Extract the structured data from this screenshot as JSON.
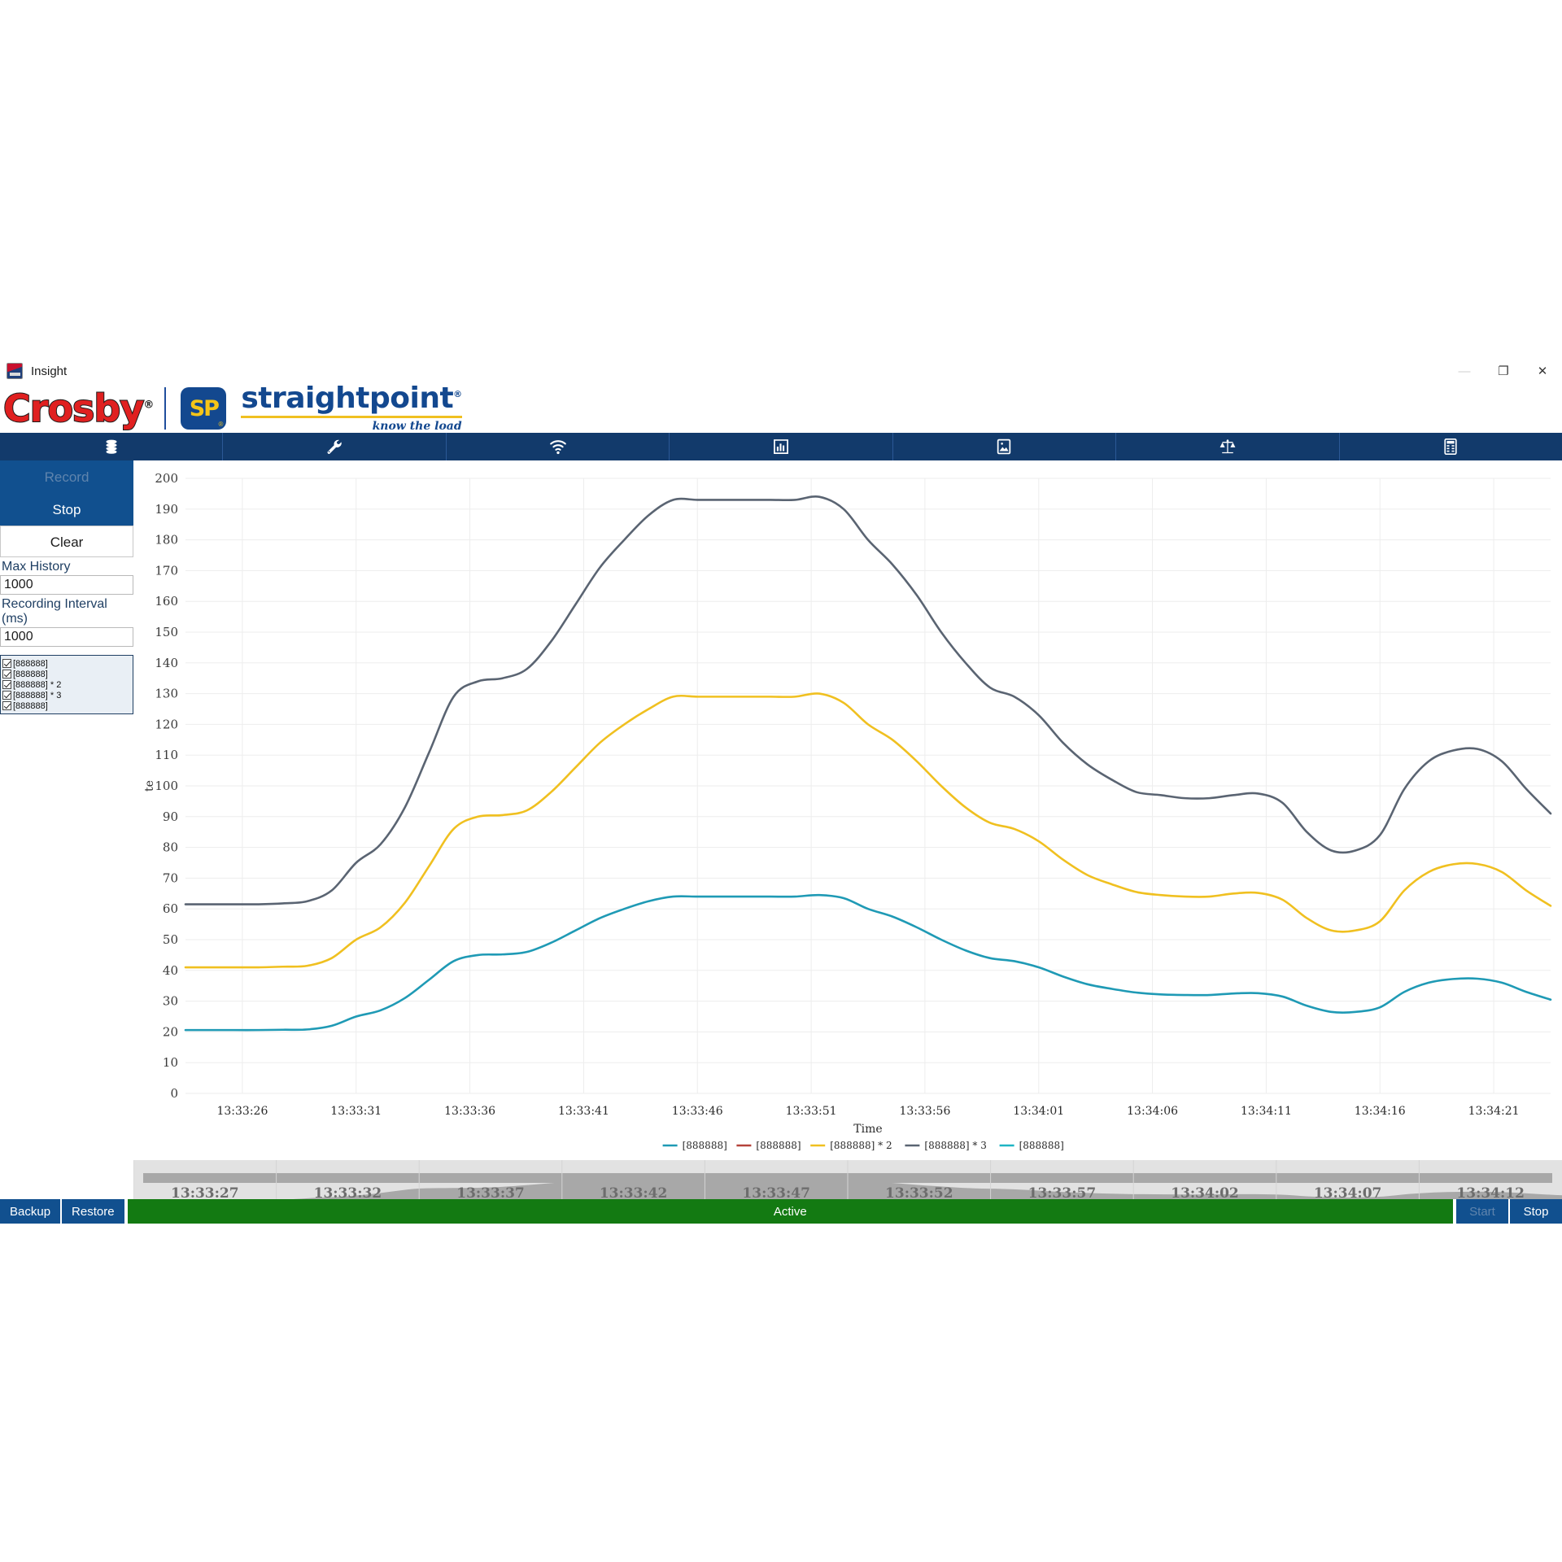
{
  "window": {
    "title": "Insight",
    "app_icon": "insight-app-icon",
    "controls": [
      {
        "name": "minimize",
        "glyph": "—",
        "disabled": true
      },
      {
        "name": "restore",
        "glyph": "❐",
        "disabled": false
      },
      {
        "name": "close",
        "glyph": "✕",
        "disabled": false
      }
    ]
  },
  "brand": {
    "crosby": "Crosby",
    "registered_mark": "®",
    "sp_badge": "SP",
    "straightpoint": "straightpoint",
    "tagline": "know the load",
    "brand_blue": "#13488f",
    "brand_red": "#e02020",
    "brand_yellow": "#f0c020"
  },
  "navbar": {
    "background": "#123a6b",
    "items": [
      {
        "name": "database-icon",
        "label": "Database"
      },
      {
        "name": "wrench-icon",
        "label": "Tools"
      },
      {
        "name": "wifi-icon",
        "label": "Wireless"
      },
      {
        "name": "bar-chart-icon",
        "label": "Charts"
      },
      {
        "name": "image-icon",
        "label": "Images"
      },
      {
        "name": "scales-icon",
        "label": "Calibration"
      },
      {
        "name": "calculator-icon",
        "label": "Reports"
      }
    ]
  },
  "sidebar": {
    "record_label": "Record",
    "record_disabled": true,
    "stop_label": "Stop",
    "clear_label": "Clear",
    "max_history_label": "Max History",
    "max_history_value": "1000",
    "recording_interval_label": "Recording Interval (ms)",
    "recording_interval_value": "1000",
    "series_checkboxes": [
      {
        "label": "[888888]",
        "checked": true
      },
      {
        "label": "[888888]",
        "checked": true
      },
      {
        "label": "[888888] * 2",
        "checked": true
      },
      {
        "label": "[888888] * 3",
        "checked": true
      },
      {
        "label": "[888888]",
        "checked": true
      }
    ]
  },
  "statusbar": {
    "backup_label": "Backup",
    "restore_label": "Restore",
    "status_text": "Active",
    "status_color": "#137a12",
    "start_label": "Start",
    "start_disabled": true,
    "stop_label": "Stop"
  },
  "navigator": {
    "ticks": [
      "13:33:27",
      "13:33:32",
      "13:33:37",
      "13:33:42",
      "13:33:47",
      "13:33:52",
      "13:33:57",
      "13:34:02",
      "13:34:07",
      "13:34:12"
    ],
    "track_color": "#e2e2e2",
    "area_color": "#a8a8a8",
    "handle_color": "#a8a8a8"
  },
  "chart_data": {
    "type": "line",
    "title": "",
    "xlabel": "Time",
    "ylabel": "te",
    "ylim": [
      0,
      200
    ],
    "ytick_step": 10,
    "yticks": [
      0,
      10,
      20,
      30,
      40,
      50,
      60,
      70,
      80,
      90,
      100,
      110,
      120,
      130,
      140,
      150,
      160,
      170,
      180,
      190,
      200
    ],
    "xticks": [
      "13:33:26",
      "13:33:31",
      "13:33:36",
      "13:33:41",
      "13:33:46",
      "13:33:51",
      "13:33:56",
      "13:34:01",
      "13:34:06",
      "13:34:11",
      "13:34:16",
      "13:34:21"
    ],
    "grid": true,
    "legend_position": "bottom",
    "x": [
      0,
      1,
      2,
      3,
      4,
      5,
      6,
      7,
      8,
      9,
      10,
      11,
      12,
      13,
      14,
      15,
      16,
      17,
      18,
      19,
      20,
      21,
      22,
      23,
      24,
      25,
      26,
      27,
      28,
      29,
      30,
      31,
      32,
      33,
      34,
      35,
      36,
      37,
      38,
      39,
      40,
      41,
      42,
      43,
      44,
      45,
      46,
      47,
      48,
      49,
      50,
      51,
      52,
      53,
      54,
      55,
      56
    ],
    "series": [
      {
        "name": "[888888]",
        "color": "#1f9ab5",
        "legend_label": "[888888]",
        "visible": true,
        "values": [
          20.6,
          20.6,
          20.6,
          20.6,
          20.7,
          20.8,
          22,
          25,
          27,
          31,
          37,
          43,
          45,
          45.2,
          46,
          49,
          53,
          57,
          60,
          62.5,
          64,
          64,
          64,
          64,
          64,
          64,
          64.5,
          63.5,
          60,
          57.5,
          54,
          50,
          46.5,
          44,
          43,
          41,
          38,
          35.5,
          34,
          32.8,
          32.2,
          32,
          32,
          32.5,
          32.6,
          31.5,
          28.5,
          26.5,
          26.5,
          28,
          33,
          36,
          37.2,
          37.3,
          36,
          33,
          30.5
        ]
      },
      {
        "name": "[888888]",
        "color": "#b5433b",
        "legend_label": "[888888]",
        "visible": false,
        "values": []
      },
      {
        "name": "[888888] * 2",
        "color": "#f0c020",
        "legend_label": "[888888] * 2",
        "visible": true,
        "values": [
          41,
          41,
          41,
          41,
          41.2,
          41.5,
          44,
          50,
          54,
          62,
          74,
          86,
          90,
          90.5,
          92,
          98,
          106,
          114,
          120,
          125,
          129,
          129,
          129,
          129,
          129,
          129,
          130,
          127,
          120,
          115,
          108,
          100,
          93,
          88,
          86,
          82,
          76,
          71,
          68,
          65.5,
          64.5,
          64,
          64,
          65,
          65.2,
          63,
          57,
          53,
          53,
          56,
          66,
          72,
          74.5,
          74.6,
          72,
          66,
          61
        ]
      },
      {
        "name": "[888888] * 3",
        "color": "#5a6472",
        "legend_label": "[888888] * 3",
        "visible": true,
        "values": [
          61.5,
          61.5,
          61.5,
          61.5,
          61.8,
          62.5,
          66,
          75,
          81,
          93,
          111,
          129,
          134,
          135,
          138,
          147,
          159,
          171,
          180,
          188,
          193,
          193,
          193,
          193,
          193,
          193,
          194,
          190,
          180,
          172,
          162,
          150,
          140,
          132,
          129,
          123,
          114,
          107,
          102,
          98,
          97,
          96,
          96,
          97,
          97.5,
          94.5,
          85,
          79,
          79,
          84,
          99,
          108,
          111.5,
          112,
          108,
          99,
          91
        ]
      },
      {
        "name": "[888888]",
        "color": "#1fb5c4",
        "legend_label": "[888888]",
        "visible": false,
        "values": []
      }
    ]
  }
}
